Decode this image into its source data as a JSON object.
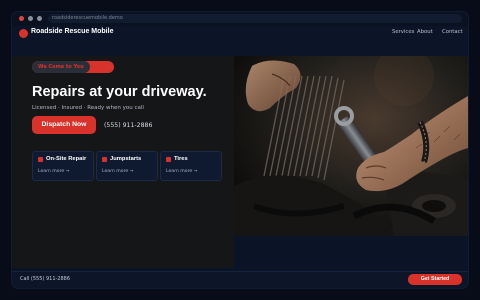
{
  "browser": {
    "url": "roadsiderescuemobile.demo"
  },
  "brand": {
    "name": "Roadside Rescue Mobile"
  },
  "nav": {
    "links": [
      "Services",
      "About",
      "Contact"
    ]
  },
  "hero": {
    "badge": "We Come to You",
    "title": "Repairs at your driveway.",
    "subtitle": "Licensed · Insured · Ready when you call",
    "cta_label": "Dispatch Now",
    "phone": "(555) 911-2886"
  },
  "services": [
    {
      "title": "On-Site Repair",
      "link": "Learn more →"
    },
    {
      "title": "Jumpstarts",
      "link": "Learn more →"
    },
    {
      "title": "Tires",
      "link": "Learn more →"
    }
  ],
  "footer": {
    "call_text": "Call (555) 911-2886",
    "cta_label": "Get Started"
  },
  "colors": {
    "accent": "#d8322b",
    "background": "#0b1426"
  }
}
